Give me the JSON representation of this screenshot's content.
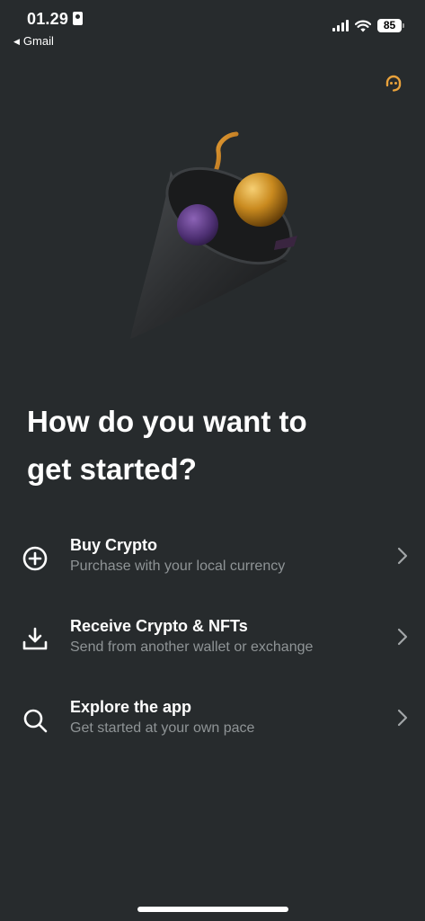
{
  "status_bar": {
    "time": "01.29",
    "back_app": "Gmail",
    "battery": "85"
  },
  "heading": {
    "line1": "How do you want to",
    "line2": "get started?"
  },
  "options": [
    {
      "title": "Buy Crypto",
      "subtitle": "Purchase with your local currency",
      "icon": "plus-circle-icon"
    },
    {
      "title": "Receive Crypto & NFTs",
      "subtitle": "Send from another wallet or exchange",
      "icon": "download-icon"
    },
    {
      "title": "Explore the app",
      "subtitle": "Get started at your own pace",
      "icon": "search-icon"
    }
  ],
  "colors": {
    "background": "#272b2d",
    "accent": "#e9a23b",
    "subtitle": "#8f9496"
  }
}
